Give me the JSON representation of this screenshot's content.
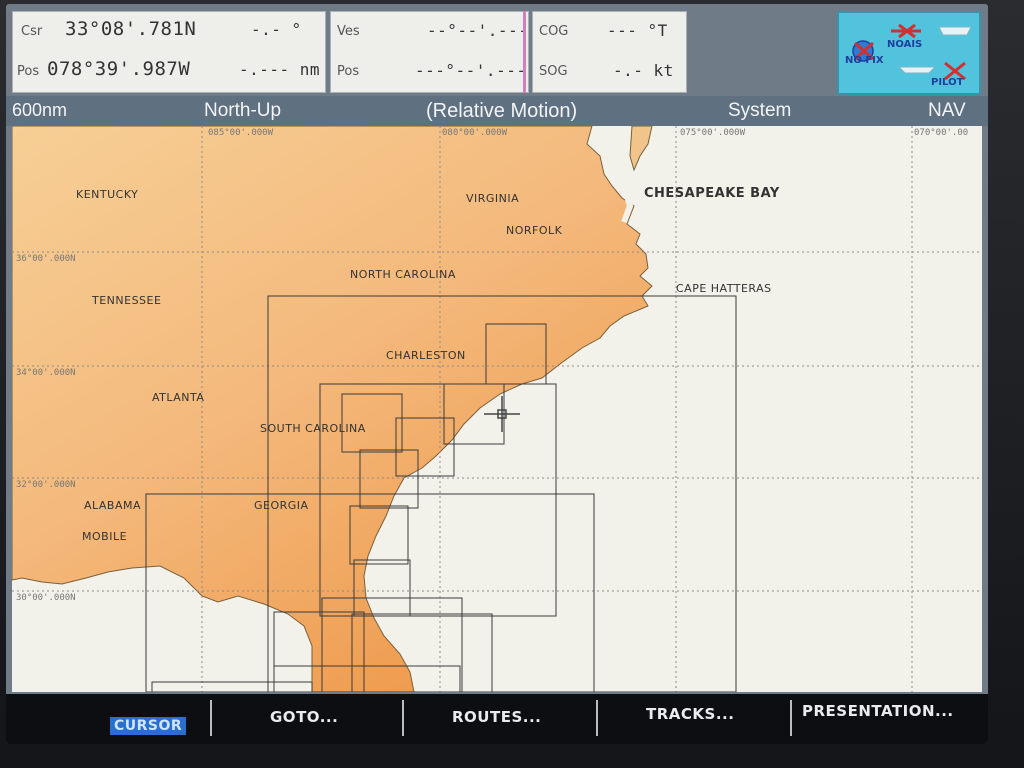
{
  "nav_panel": {
    "csr_label": "Csr",
    "csr_lat": "33°08'.781N",
    "csr_bearing": "-.- °",
    "pos_label": "Pos",
    "pos_lon": "078°39'.987W",
    "pos_range": "-.--- nm"
  },
  "ves_panel": {
    "ves_label": "Ves",
    "ves_value": "--°--'.---",
    "pos_label": "Pos",
    "pos_value": "---°--'.---"
  },
  "cog_panel": {
    "cog_label": "COG",
    "cog_value": "--- °T",
    "sog_label": "SOG",
    "sog_value": "-.- kt"
  },
  "status": {
    "nofix": "NO FIX",
    "noais": "NOAIS",
    "pilot": "PILOT",
    "color": "#51c3dc"
  },
  "topbar": {
    "range": "600nm",
    "orientation": "North-Up",
    "motion": "(Relative Motion)",
    "system": "System",
    "mode": "NAV"
  },
  "map": {
    "places": {
      "kentucky": "KENTUCKY",
      "virginia": "VIRGINIA",
      "chesapeake": "CHESAPEAKE BAY",
      "norfolk": "NORFOLK",
      "north_carolina": "NORTH CAROLINA",
      "cape_hatteras": "CAPE HATTERAS",
      "tennessee": "TENNESSEE",
      "charleston": "CHARLESTON",
      "atlanta": "ATLANTA",
      "south_carolina": "SOUTH CAROLINA",
      "alabama": "ALABAMA",
      "georgia": "GEORGIA",
      "mobile": "MOBILE"
    },
    "grid": {
      "lon_85": "085°00'.000W",
      "lon_80": "080°00'.000W",
      "lon_75": "075°00'.000W",
      "lon_70": "070°00'.00",
      "lat_36": "36°00'.000N",
      "lat_34": "34°00'.000N",
      "lat_32": "32°00'.000N",
      "lat_30": "30°00'.000N"
    },
    "land_color": "#f0b06a",
    "sea_color": "#f3f2ea"
  },
  "softkeys": {
    "cursor": "CURSOR",
    "goto": "GOTO...",
    "routes": "ROUTES...",
    "tracks": "TRACKS...",
    "presentation": "PRESENTATION..."
  }
}
